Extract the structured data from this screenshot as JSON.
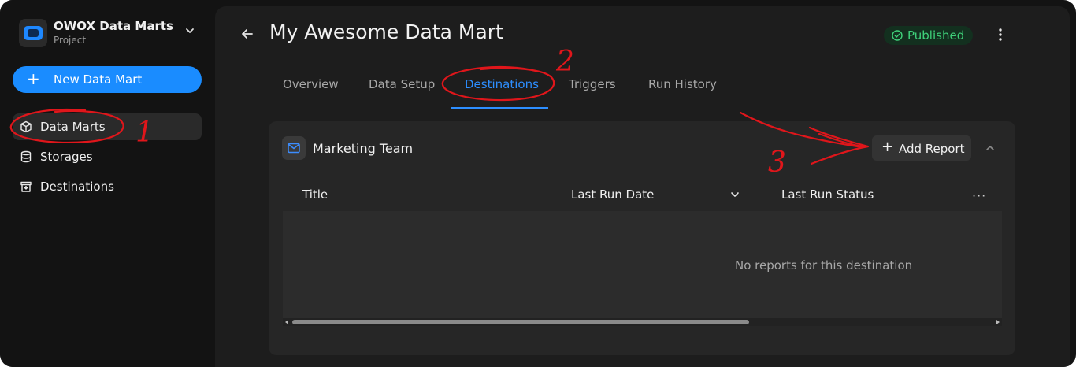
{
  "project": {
    "name": "OWOX Data Marts",
    "subtitle": "Project"
  },
  "sidebar": {
    "new_button": "New Data Mart",
    "items": [
      {
        "label": "Data Marts",
        "icon": "cube-icon",
        "active": true
      },
      {
        "label": "Storages",
        "icon": "database-icon",
        "active": false
      },
      {
        "label": "Destinations",
        "icon": "destination-icon",
        "active": false
      }
    ]
  },
  "header": {
    "title": "My Awesome Data Mart",
    "status": "Published"
  },
  "tabs": [
    {
      "label": "Overview"
    },
    {
      "label": "Data Setup"
    },
    {
      "label": "Destinations",
      "active": true
    },
    {
      "label": "Triggers"
    },
    {
      "label": "Run History"
    }
  ],
  "panel": {
    "title": "Marketing Team",
    "add_button": "Add Report",
    "columns": [
      "Title",
      "Last Run Date",
      "Last Run Status"
    ],
    "empty_text": "No reports for this destination"
  },
  "annotations": [
    "1",
    "2",
    "3"
  ],
  "colors": {
    "accent": "#1a8cff",
    "published": "#3fd17a",
    "annotation": "#e0161b"
  }
}
